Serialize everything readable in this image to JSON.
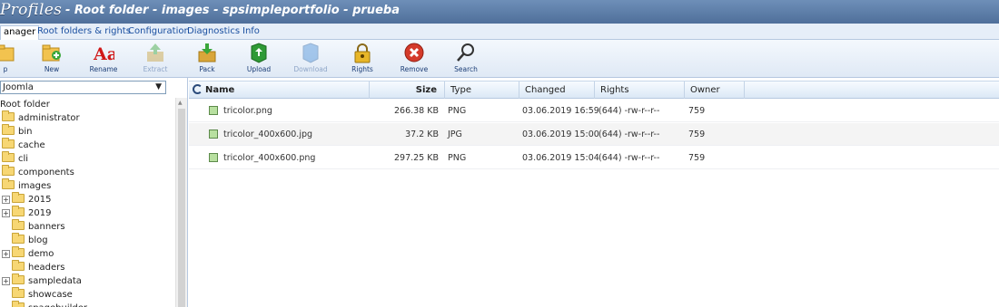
{
  "title": {
    "app": "Profiles",
    "folder_title": "- Root folder - images - spsimpleportfolio - prueba"
  },
  "tabs": [
    {
      "label": "anager"
    },
    {
      "label": "Root folders & rights"
    },
    {
      "label": "Configuration"
    },
    {
      "label": "Diagnostics"
    },
    {
      "label": "Info"
    }
  ],
  "toolbar": [
    {
      "label": "p",
      "icon": "up-folder-icon",
      "enabled": true
    },
    {
      "label": "New",
      "icon": "new-folder-icon",
      "enabled": true
    },
    {
      "label": "Rename",
      "icon": "rename-icon",
      "enabled": true
    },
    {
      "label": "Extract",
      "icon": "extract-icon",
      "enabled": false
    },
    {
      "label": "Pack",
      "icon": "pack-icon",
      "enabled": true
    },
    {
      "label": "Upload",
      "icon": "upload-icon",
      "enabled": true
    },
    {
      "label": "Download",
      "icon": "download-icon",
      "enabled": false
    },
    {
      "label": "Rights",
      "icon": "lock-icon",
      "enabled": true
    },
    {
      "label": "Remove",
      "icon": "remove-icon",
      "enabled": true
    },
    {
      "label": "Search",
      "icon": "search-icon",
      "enabled": true
    }
  ],
  "sidebar": {
    "select_value": "Joomla",
    "tree": [
      {
        "label": "Root folder",
        "level": 0,
        "expander": false,
        "folder": false
      },
      {
        "label": "administrator",
        "level": 0,
        "expander": false,
        "folder": true
      },
      {
        "label": "bin",
        "level": 0,
        "expander": false,
        "folder": true
      },
      {
        "label": "cache",
        "level": 0,
        "expander": false,
        "folder": true
      },
      {
        "label": "cli",
        "level": 0,
        "expander": false,
        "folder": true
      },
      {
        "label": "components",
        "level": 0,
        "expander": false,
        "folder": true
      },
      {
        "label": "images",
        "level": 0,
        "expander": false,
        "folder": true
      },
      {
        "label": "2015",
        "level": 0,
        "expander": true,
        "folder": true
      },
      {
        "label": "2019",
        "level": 0,
        "expander": true,
        "folder": true
      },
      {
        "label": "banners",
        "level": 1,
        "expander": false,
        "folder": true
      },
      {
        "label": "blog",
        "level": 1,
        "expander": false,
        "folder": true
      },
      {
        "label": "demo",
        "level": 0,
        "expander": true,
        "folder": true
      },
      {
        "label": "headers",
        "level": 1,
        "expander": false,
        "folder": true
      },
      {
        "label": "sampledata",
        "level": 0,
        "expander": true,
        "folder": true
      },
      {
        "label": "showcase",
        "level": 1,
        "expander": false,
        "folder": true
      },
      {
        "label": "spagebuilder",
        "level": 1,
        "expander": false,
        "folder": true
      }
    ]
  },
  "table": {
    "columns": {
      "name": "Name",
      "size": "Size",
      "type": "Type",
      "changed": "Changed",
      "rights": "Rights",
      "owner": "Owner"
    },
    "rows": [
      {
        "name": "tricolor.png",
        "size": "266.38 KB",
        "type": "PNG",
        "changed": "03.06.2019 16:59",
        "rights": "(644) -rw-r--r--",
        "owner": "759"
      },
      {
        "name": "tricolor_400x600.jpg",
        "size": "37.2 KB",
        "type": "JPG",
        "changed": "03.06.2019 15:00",
        "rights": "(644) -rw-r--r--",
        "owner": "759"
      },
      {
        "name": "tricolor_400x600.png",
        "size": "297.25 KB",
        "type": "PNG",
        "changed": "03.06.2019 15:04",
        "rights": "(644) -rw-r--r--",
        "owner": "759"
      }
    ]
  }
}
